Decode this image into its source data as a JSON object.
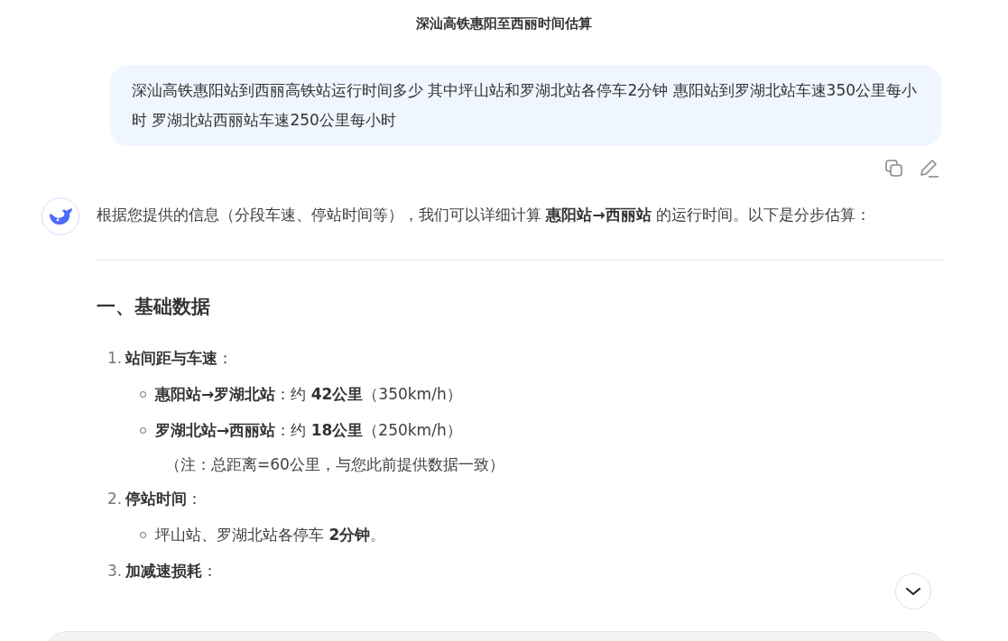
{
  "header": {
    "title": "深汕高铁惠阳至西丽时间估算"
  },
  "user_message": {
    "text": "深汕高铁惠阳站到西丽高铁站运行时间多少 其中坪山站和罗湖北站各停车2分钟 惠阳站到罗湖北站车速350公里每小时 罗湖北站西丽站车速250公里每小时"
  },
  "message_actions": [
    {
      "kind": "copy"
    },
    {
      "kind": "edit"
    }
  ],
  "reply": {
    "intro": "根据您提供的信息（分段车速、停站时间等），我们可以详细计算 **惠阳站→西丽站** 的运行时间。以下是分步估算：",
    "sections": [
      {
        "heading": "一、基础数据",
        "items": [
          {
            "number": "1.",
            "text": "**站间距与车速**：",
            "children": [
              {
                "text": "**惠阳站→罗湖北站**：约 **42公里**（350km/h）"
              },
              {
                "text": "**罗湖北站→西丽站**：约 **18公里**（250km/h）",
                "note": "（注：总距离=60公里，与您此前提供数据一致）"
              }
            ]
          },
          {
            "number": "2.",
            "text": "**停站时间**：",
            "children": [
              {
                "text": "坪山站、罗湖北站各停车 **2分钟**。"
              }
            ]
          },
          {
            "number": "3.",
            "text": "**加减速损耗**："
          }
        ]
      }
    ]
  }
}
